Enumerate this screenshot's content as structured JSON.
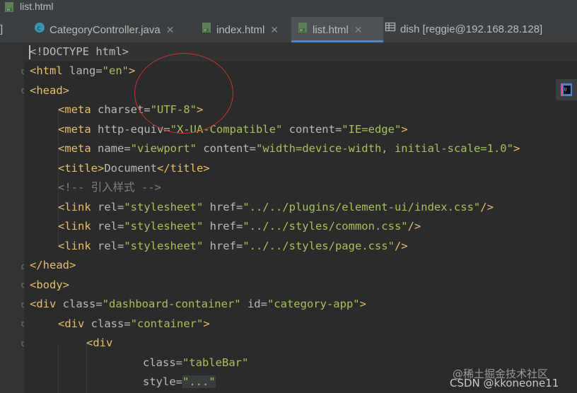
{
  "window": {
    "title": "list.html"
  },
  "tabs": [
    {
      "label": "]",
      "icon": "",
      "active": false
    },
    {
      "label": "CategoryController.java",
      "icon": "java-class-icon",
      "active": false
    },
    {
      "label": "index.html",
      "icon": "html-file-icon",
      "active": false
    },
    {
      "label": "list.html",
      "icon": "html-file-icon",
      "active": true
    },
    {
      "label": "dish [reggie@192.168.28.128]",
      "icon": "table-icon",
      "active": false
    }
  ],
  "code": {
    "l1_doctype": "<!DOCTYPE html>",
    "l2_a": "<html ",
    "l2_b": "lang=",
    "l2_c": "\"en\"",
    "l2_d": ">",
    "l3": "<head>",
    "l4_a": "<meta ",
    "l4_b": "charset=",
    "l4_c": "\"UTF-8\"",
    "l4_d": ">",
    "l5_a": "<meta ",
    "l5_b": "http-equiv=",
    "l5_c": "\"X-UA-Compatible\"",
    "l5_d": " content=",
    "l5_e": "\"IE=edge\"",
    "l5_f": ">",
    "l6_a": "<meta ",
    "l6_b": "name=",
    "l6_c": "\"viewport\"",
    "l6_d": " content=",
    "l6_e": "\"width=device-width, initial-scale=1.0\"",
    "l6_f": ">",
    "l7_a": "<title>",
    "l7_b": "Document",
    "l7_c": "</title>",
    "l8": "<!-- 引入样式 -->",
    "l9_a": "<link ",
    "l9_b": "rel=",
    "l9_c": "\"stylesheet\"",
    "l9_d": " href=",
    "l9_e": "\"../../plugins/element-ui/index.css\"",
    "l9_f": "/>",
    "l10_a": "<link ",
    "l10_b": "rel=",
    "l10_c": "\"stylesheet\"",
    "l10_d": " href=",
    "l10_e": "\"../../styles/common.css\"",
    "l10_f": "/>",
    "l11_a": "<link ",
    "l11_b": "rel=",
    "l11_c": "\"stylesheet\"",
    "l11_d": " href=",
    "l11_e": "\"../../styles/page.css\"",
    "l11_f": "/>",
    "l12": "</head>",
    "l13": "<body>",
    "l14_a": "<div ",
    "l14_b": "class=",
    "l14_c": "\"dashboard-container\"",
    "l14_d": " id=",
    "l14_e": "\"category-app\"",
    "l14_f": ">",
    "l15_a": "<div ",
    "l15_b": "class=",
    "l15_c": "\"container\"",
    "l15_d": ">",
    "l16": "<div",
    "l17_a": "class=",
    "l17_b": "\"tableBar\"",
    "l18_a": "style=",
    "l18_b": "\"...\""
  },
  "watermarks": {
    "top": "@稀土掘金技术社区",
    "bottom": "CSDN @kkoneone11"
  },
  "colors": {
    "tag": "#e8bf6a",
    "string": "#a5c25c",
    "attr": "#bababa",
    "comment": "#808080",
    "active_tab_underline": "#4a88c7"
  }
}
